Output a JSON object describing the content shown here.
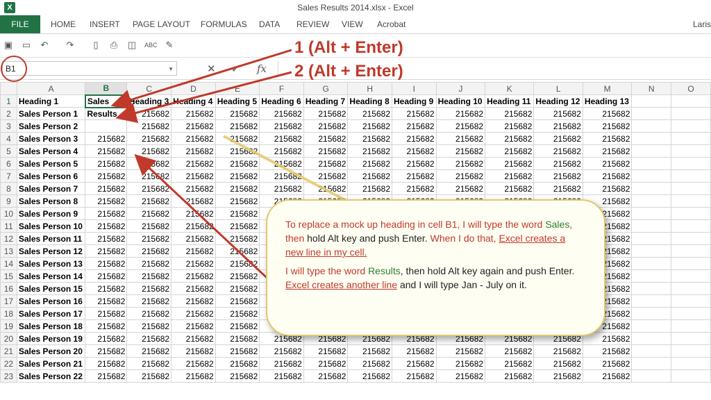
{
  "window": {
    "title": "Sales Results 2014.xlsx - Excel",
    "user": "Laris"
  },
  "ribbon": {
    "tabs": [
      "FILE",
      "HOME",
      "INSERT",
      "PAGE LAYOUT",
      "FORMULAS",
      "DATA",
      "REVIEW",
      "VIEW",
      "Acrobat"
    ]
  },
  "formula_bar": {
    "namebox": "B1"
  },
  "columns": [
    "",
    "A",
    "B",
    "C",
    "D",
    "E",
    "F",
    "G",
    "H",
    "I",
    "J",
    "K",
    "L",
    "M",
    "N",
    "O"
  ],
  "headings": [
    "Heading 1",
    "Sales",
    "Heading 3",
    "Heading 4",
    "Heading 5",
    "Heading 6",
    "Heading 7",
    "Heading 8",
    "Heading 9",
    "Heading 10",
    "Heading 11",
    "Heading 12",
    "Heading 13"
  ],
  "cell_b2": "Results",
  "cell_value": "215682",
  "sales_people": [
    "Sales Person 1",
    "Sales Person 2",
    "Sales Person 3",
    "Sales Person 4",
    "Sales Person 5",
    "Sales Person 6",
    "Sales Person 7",
    "Sales Person 8",
    "Sales Person 9",
    "Sales Person 10",
    "Sales Person 11",
    "Sales Person 12",
    "Sales Person 13",
    "Sales Person 14",
    "Sales Person 15",
    "Sales Person 16",
    "Sales Person 17",
    "Sales Person 18",
    "Sales Person 19",
    "Sales Person 20",
    "Sales Person 21",
    "Sales Person 22"
  ],
  "annotations": {
    "first": "1 (Alt + Enter)",
    "second": "2 (Alt + Enter)"
  },
  "callout": {
    "p1_a": "To replace a mock up heading in cell B1, I will type the word ",
    "p1_sales": "Sales",
    "p1_b": ", then ",
    "p1_c": "hold Alt key and push Enter.",
    "p1_d": " When I do that, ",
    "p1_e": "Excel creates a new line in my cell.",
    "p2_a": "I will type the word ",
    "p2_results": "Results",
    "p2_b": ", then hold Alt key again and push Enter. ",
    "p2_c": "Excel creates another line",
    "p2_d": " and I will type Jan - July on it."
  },
  "icons": [
    "excel-logo-icon",
    "save-icon",
    "undo-icon",
    "redo-icon",
    "cancel-icon",
    "enter-icon",
    "function-icon"
  ],
  "colors": {
    "excel_green": "#217346",
    "annotation_red": "#c0392b",
    "callout_border": "#e3c86a"
  }
}
